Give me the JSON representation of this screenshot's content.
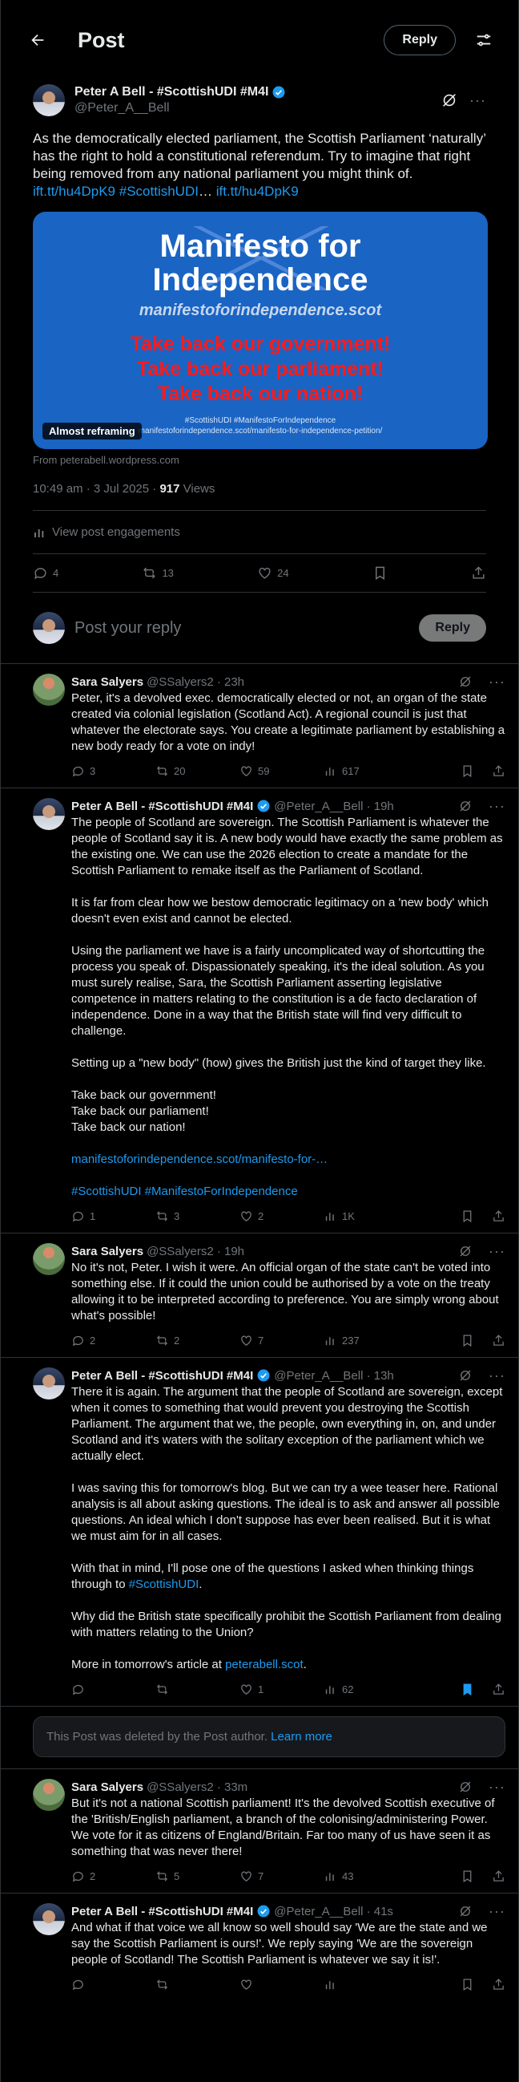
{
  "header": {
    "title": "Post",
    "reply_button": "Reply"
  },
  "post": {
    "display_name": "Peter A Bell - #ScottishUDI #M4I",
    "handle": "@Peter_A__Bell",
    "text_before": "As the democratically elected parliament, the Scottish Parliament ‘naturally’ has the right to hold a constitutional referendum. Try to imagine that right being removed from any national parliament you might think of. ",
    "link1": "ift.tt/hu4DpK9",
    "hashtag": "#ScottishUDI",
    "ellipsis": "… ",
    "link2": "ift.tt/hu4DpK9",
    "card": {
      "title_line1": "Manifesto for",
      "title_line2": "Independence",
      "site": "manifestoforindependence.scot",
      "slogan1": "Take back our government!",
      "slogan2": "Take back our parliament!",
      "slogan3": "Take back our nation!",
      "small1": "#ScottishUDI #ManifestoForIndependence",
      "small2": "manifestoforindependence.scot/manifesto-for-independence-petition/",
      "badge": "Almost reframing"
    },
    "from": "From peterabell.wordpress.com",
    "time": "10:49 am · 3 Jul 2025 · ",
    "views_count": "917",
    "views_label": " Views",
    "engagements": "View post engagements",
    "replies": "4",
    "reposts": "13",
    "likes": "24"
  },
  "composer": {
    "placeholder": "Post your reply",
    "button": "Reply"
  },
  "replies": [
    {
      "name": "Sara Salyers",
      "handle": "@SSalyers2 · 23h",
      "text": "Peter, it's a devolved exec. democratically elected or not, an organ of the state created via colonial legislation (Scotland Act). A regional council is just that whatever the electorate says. You create a legitimate parliament by establishing a new body ready for a vote on indy!",
      "replies": "3",
      "reposts": "20",
      "likes": "59",
      "views": "617"
    },
    {
      "name": "Peter A Bell - #ScottishUDI #M4I",
      "handle": "@Peter_A__Bell · 19h",
      "text": "The people of Scotland are sovereign. The Scottish Parliament is whatever the people of Scotland say it is. A new body would have exactly the same problem as the existing one. We can use the 2026 election to create a mandate for the Scottish Parliament to remake itself as the Parliament of Scotland.\n\nIt is far from clear how we bestow democratic legitimacy on a 'new body' which doesn't even exist and cannot be elected.\n\nUsing the parliament we have is a fairly uncomplicated way of shortcutting the process you speak of. Dispassionately speaking, it's the ideal solution. As you must surely realise, Sara, the Scottish Parliament asserting legislative competence in matters relating to the constitution is a de facto declaration of independence. Done in a way that the British state will find very difficult to challenge.\n\nSetting up a \"new body\" (how) gives the British just the kind of target they like.\n\nTake back our government!\nTake back our parliament!\nTake back our nation!",
      "link": "manifestoforindependence.scot/manifesto-for-…",
      "tags": "#ScottishUDI #ManifestoForIndependence",
      "replies": "1",
      "reposts": "3",
      "likes": "2",
      "views": "1K"
    },
    {
      "name": "Sara Salyers",
      "handle": "@SSalyers2 · 19h",
      "text": "No it's not, Peter. I wish it were. An official organ of the state can't be voted into something else. If it could the union could be authorised by a vote on the treaty allowing it to be interpreted according to preference. You are simply wrong about what's possible!",
      "replies": "2",
      "reposts": "2",
      "likes": "7",
      "views": "237"
    },
    {
      "name": "Peter A Bell - #ScottishUDI #M4I",
      "handle": "@Peter_A__Bell · 13h",
      "text": "There it is again. The argument that the people of Scotland are sovereign, except when it comes to something that would prevent you destroying the Scottish Parliament. The argument that we, the people, own everything in, on, and under Scotland and it's waters with the solitary exception of the parliament which we actually elect.\n\nI was saving this for tomorrow's blog. But we can try a wee teaser here. Rational analysis is all about asking questions. The ideal is to ask and answer all possible questions. An ideal which I don't suppose has ever been realised. But it is what we must aim for in all cases.\n\nWith that in mind, I'll pose one of the questions I asked when thinking things through to ",
      "inline_tag": "#ScottishUDI",
      "text2": ".\n\nWhy did the British state specifically prohibit the Scottish Parliament from dealing with matters relating to the Union?\n\nMore in tomorrow's article at ",
      "inline_link": "peterabell.scot",
      "text3": ".",
      "replies": "",
      "reposts": "",
      "likes": "1",
      "views": "62"
    },
    {
      "name": "Sara Salyers",
      "handle": "@SSalyers2 · 33m",
      "text": "But it's not a national Scottish parliament! It's the devolved Scottish executive of the 'British/English parliament, a branch of the colonising/administering Power. We vote for it as citizens of England/Britain. Far too many of us have seen it as something that was never there!",
      "replies": "2",
      "reposts": "5",
      "likes": "7",
      "views": "43"
    },
    {
      "name": "Peter A Bell - #ScottishUDI #M4I",
      "handle": "@Peter_A__Bell · 41s",
      "text": "And what if that voice we all know so well should say 'We are the state and we say the Scottish Parliament is ours!'.  We reply saying 'We are the sovereign people of Scotland! The Scottish Parliament is whatever we say it is!'.",
      "replies": "",
      "reposts": "",
      "likes": "",
      "views": ""
    }
  ],
  "deleted_notice": {
    "text": "This Post was deleted by the Post author. ",
    "link": "Learn more"
  },
  "colors": {
    "accent": "#1d9bf0",
    "background": "#000000",
    "muted": "#71767b",
    "card_blue": "#1a64c3",
    "slogan_red": "#ff1a1a"
  },
  "icons": [
    "back-arrow-icon",
    "filter-icon",
    "verified-icon",
    "grok-icon",
    "more-icon",
    "reply-icon",
    "repost-icon",
    "like-icon",
    "views-icon",
    "bookmark-icon",
    "share-icon",
    "chart-icon"
  ]
}
